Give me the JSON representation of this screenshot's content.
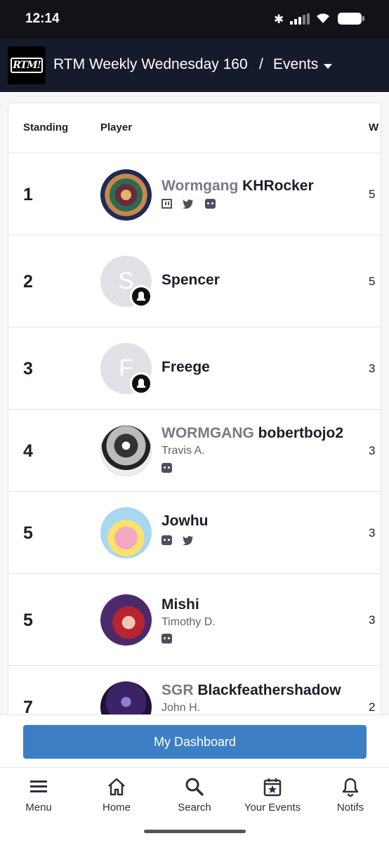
{
  "status_bar": {
    "time": "12:14"
  },
  "app_bar": {
    "logo_text": "RTM!",
    "title": "RTM Weekly Wednesday 160",
    "separator": "/",
    "section": "Events"
  },
  "table": {
    "headers": {
      "standing": "Standing",
      "player": "Player",
      "wins": "W"
    },
    "rows": [
      {
        "standing": "1",
        "prefix": "Wormgang",
        "name": "KHRocker",
        "real_name": "",
        "wins": "5",
        "socials": [
          "twitch-icon",
          "twitter-icon",
          "discord-icon"
        ]
      },
      {
        "standing": "2",
        "prefix": "",
        "name": "Spencer",
        "real_name": "",
        "wins": "5",
        "avatar_letter": "S"
      },
      {
        "standing": "3",
        "prefix": "",
        "name": "Freege",
        "real_name": "",
        "wins": "3",
        "avatar_letter": "F"
      },
      {
        "standing": "4",
        "prefix": "WORMGANG",
        "name": "bobertbojo2",
        "real_name": "Travis A.",
        "wins": "3",
        "socials": [
          "discord-icon"
        ]
      },
      {
        "standing": "5",
        "prefix": "",
        "name": "Jowhu",
        "real_name": "",
        "wins": "3",
        "socials": [
          "discord-icon",
          "twitter-icon"
        ]
      },
      {
        "standing": "5",
        "prefix": "",
        "name": "Mishi",
        "real_name": "Timothy D.",
        "wins": "3",
        "socials": [
          "discord-icon"
        ]
      },
      {
        "standing": "7",
        "prefix": "SGR",
        "name": "Blackfeathershadow",
        "real_name": "John H.",
        "wins": "2"
      }
    ]
  },
  "dashboard_button": "My Dashboard",
  "tabs": [
    {
      "label": "Menu",
      "icon": "menu-icon"
    },
    {
      "label": "Home",
      "icon": "home-icon"
    },
    {
      "label": "Search",
      "icon": "search-icon"
    },
    {
      "label": "Your Events",
      "icon": "calendar-star-icon"
    },
    {
      "label": "Notifs",
      "icon": "bell-icon"
    }
  ],
  "colors": {
    "header_bg": "#161b2b",
    "accent_button": "#3d7fc4",
    "prefix_text": "#767b87"
  }
}
